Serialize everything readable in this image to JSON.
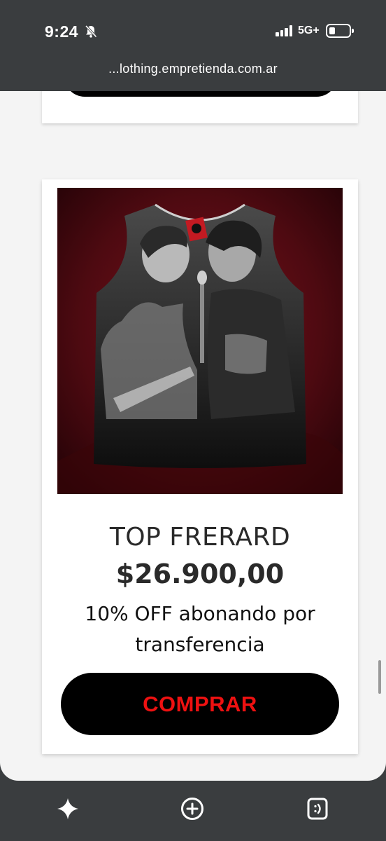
{
  "status": {
    "time": "9:24",
    "network": "5G+",
    "icons": [
      "bell-muted-icon",
      "signal-icon",
      "battery-icon"
    ],
    "signal_level": 4,
    "battery_level": 0.2
  },
  "browser": {
    "url": "...lothing.empretienda.com.ar"
  },
  "product": {
    "name": "TOP FRERARD",
    "price": "$26.900,00",
    "promo": "10% OFF abonando por transferencia",
    "buy_label": "COMPRAR",
    "image_icon": "product-photo"
  },
  "colors": {
    "buy_text": "#ee1111",
    "buy_button": "#000000",
    "chrome": "#3a3d3f",
    "page_bg": "#f4f4f4"
  },
  "bottom_nav": {
    "icons": [
      "sparkle-icon",
      "add-circle-icon",
      "tabs-icon"
    ]
  }
}
